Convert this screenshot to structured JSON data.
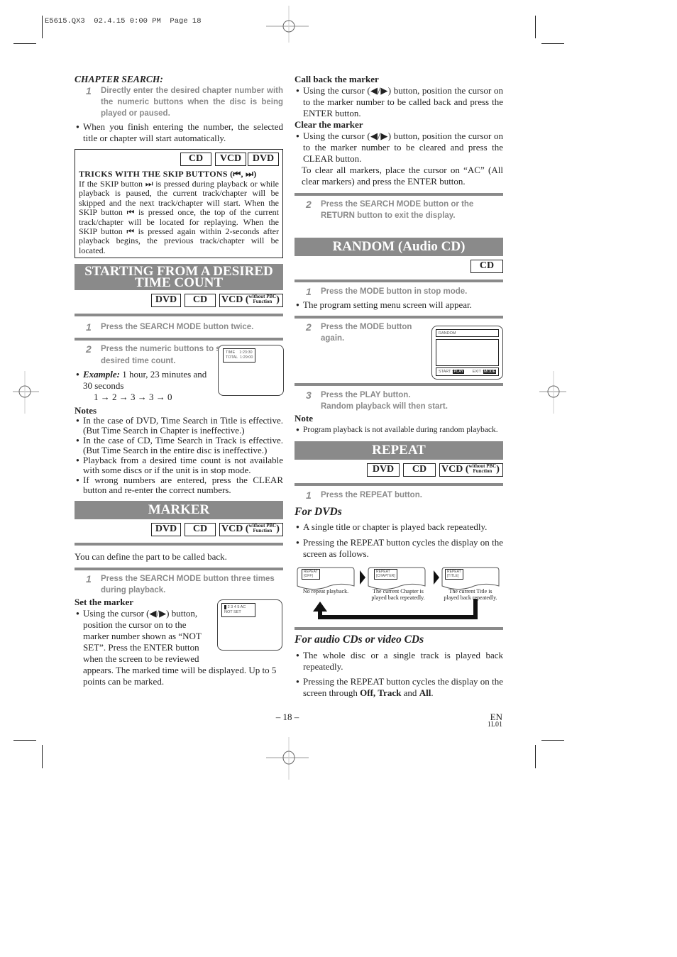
{
  "header": {
    "slug": "E5615.QX3  02.4.15 0:00 PM  Page 18"
  },
  "chapter_search": {
    "title": "CHAPTER SEARCH:",
    "step1_num": "1",
    "step1": "Directly enter the desired chapter number with the numeric buttons when the disc is being played or paused.",
    "bullet": "When you finish entering the number, the selected title or chapter will start automatically."
  },
  "tricks": {
    "badges": [
      "CD",
      "VCD",
      "DVD"
    ],
    "title": "TRICKS WITH THE SKIP BUTTONS (⏮, ⏭)",
    "body": "If the SKIP button ⏭ is pressed during playback or while playback is paused, the current track/chapter will be skipped and the next track/chapter will start. When the SKIP button ⏮ is pressed once, the top of the current track/chapter will be located for replaying. When the SKIP button ⏮ is pressed again within 2-seconds after playback begins, the previous track/chapter will be located."
  },
  "time_count": {
    "title_line1": "STARTING FROM A DESIRED",
    "title_line2": "TIME COUNT",
    "badges": [
      "DVD",
      "CD",
      "VCD"
    ],
    "vcd_note_1": "without PBC",
    "vcd_note_2": "Function",
    "step1_num": "1",
    "step1": "Press the SEARCH MODE button twice.",
    "step2_num": "2",
    "step2": "Press the numeric buttons to set the desired time count.",
    "example_label": "Example:",
    "example_text": "1 hour, 23 minutes and 30 seconds",
    "example_seq": "1 → 2 → 3 → 3 → 0",
    "osd_line1": "TIME    1:23:30",
    "osd_line2": "TOTAL  1:29:00",
    "notes_title": "Notes",
    "notes": [
      "In the case of DVD, Time Search in Title is effective. (But Time Search in Chapter is ineffective.)",
      "In the case of CD, Time Search in Track is effective. (But Time Search in the entire disc is ineffective.)",
      "Playback from a desired time count is not available with some discs or if the unit is in stop mode.",
      "If wrong numbers are entered, press the CLEAR button and re-enter the correct numbers."
    ]
  },
  "marker": {
    "title": "MARKER",
    "badges": [
      "DVD",
      "CD",
      "VCD"
    ],
    "vcd_note_1": "without PBC",
    "vcd_note_2": "Function",
    "intro": "You can define the part to be called back.",
    "step1_num": "1",
    "step1": "Press the SEARCH MODE button three times during playback.",
    "set_title": "Set the marker",
    "set_body_a": "Using the cursor (◀/▶) button, position the cursor on to the marker number shown as “NOT SET”. Press the ENTER button when the screen to be reviewed",
    "set_body_b": "appears. The marked time will be displayed. Up to 5 points can be marked.",
    "osd_line1": "1 2 3 4 5 AC",
    "osd_line2": "NOT SET",
    "call_title": "Call back the marker",
    "call_body": "Using the cursor (◀/▶) button, position the cursor on to the marker number to be called back and press the ENTER button.",
    "clear_title": "Clear the marker",
    "clear_body": "Using the cursor (◀/▶) button, position the cursor on to the marker number to be cleared and press the CLEAR button.",
    "clear_all": "To clear all markers, place the cursor on “AC” (All clear markers) and press the ENTER button.",
    "step2_num": "2",
    "step2": "Press the SEARCH MODE button or the RETURN button to exit the display."
  },
  "random": {
    "title": "RANDOM (Audio CD)",
    "badges": [
      "CD"
    ],
    "step1_num": "1",
    "step1": "Press the MODE button in stop mode.",
    "bullet": "The program setting menu screen will appear.",
    "step2_num": "2",
    "step2": "Press the MODE button again.",
    "osd_title": "RANDOM",
    "osd_start": "START :",
    "osd_start_key": "PLAY",
    "osd_exit": "EXIT :",
    "osd_exit_key": "MODE",
    "step3_num": "3",
    "step3_a": "Press the PLAY button.",
    "step3_b": "Random playback will then start.",
    "note_title": "Note",
    "note": "Program playback is not available during random playback."
  },
  "repeat": {
    "title": "REPEAT",
    "badges": [
      "DVD",
      "CD",
      "VCD"
    ],
    "vcd_note_1": "without PBC",
    "vcd_note_2": "Function",
    "step1_num": "1",
    "step1": "Press the REPEAT button.",
    "dvd_title": "For DVDs",
    "dvd_bullets": [
      "A single title or chapter is played back repeatedly.",
      "Pressing the REPEAT button cycles the display on the screen as follows."
    ],
    "cycle": [
      {
        "osd1": "REPEAT",
        "osd2": "[OFF]",
        "caption1": "No repeat playback.",
        "caption2": ""
      },
      {
        "osd1": "REPEAT",
        "osd2": "[CHAPTER]",
        "caption1": "The current Chapter is",
        "caption2": "played back repeatedly."
      },
      {
        "osd1": "REPEAT",
        "osd2": "[TITLE]",
        "caption1": "The current Title is",
        "caption2": "played back repeatedly."
      }
    ],
    "cd_title": "For audio CDs or video CDs",
    "cd_bullet1": "The whole disc or a single track is played back repeatedly.",
    "cd_bullet2_a": "Pressing the REPEAT button cycles the display on the screen through ",
    "cd_bullet2_off": "Off,",
    "cd_bullet2_track": "Track",
    "cd_bullet2_and": " and ",
    "cd_bullet2_all": "All",
    "cd_bullet2_end": "."
  },
  "footer": {
    "page": "– 18 –",
    "lang": "EN",
    "code": "1L01"
  }
}
